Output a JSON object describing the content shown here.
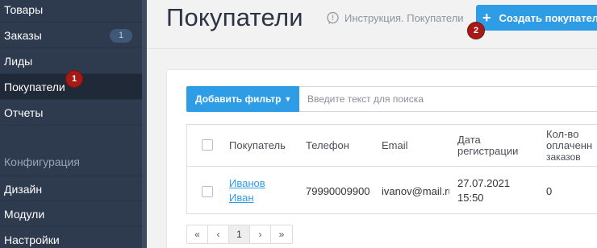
{
  "sidebar": {
    "items": [
      {
        "label": "Товары",
        "badge": ""
      },
      {
        "label": "Заказы",
        "badge": "1"
      },
      {
        "label": "Лиды",
        "badge": ""
      },
      {
        "label": "Покупатели",
        "badge": "",
        "active": true
      },
      {
        "label": "Отчеты",
        "badge": ""
      }
    ],
    "section_label": "Конфигурация",
    "config_items": [
      {
        "label": "Дизайн"
      },
      {
        "label": "Модули"
      },
      {
        "label": "Настройки"
      }
    ]
  },
  "markers": [
    "1",
    "2"
  ],
  "header": {
    "title": "Покупатели",
    "help_link": "Инструкция. Покупатели",
    "create_button": "Создать покупателя",
    "create_icon": "+"
  },
  "filter": {
    "add_filter_label": "Добавить фильтр",
    "search_placeholder": "Введите текст для поиска"
  },
  "table": {
    "columns": [
      "Покупатель",
      "Телефон",
      "Email",
      "Дата регистрации",
      "Кол-во оплаченных заказов"
    ],
    "column_lines": {
      "date": [
        "Дата",
        "регистрации"
      ],
      "orders": [
        "Кол-во",
        "оплаченн",
        "заказов"
      ]
    },
    "rows": [
      {
        "name_line1": "Иванов",
        "name_line2": "Иван",
        "phone": "79990009900",
        "email": "ivanov@mail.ru",
        "date_line1": "27.07.2021",
        "date_line2": "15:50",
        "orders": "0"
      }
    ]
  },
  "pagination": {
    "first": "«",
    "prev": "‹",
    "current": "1",
    "next": "›",
    "last": "»"
  },
  "colors": {
    "sidebar": "#2e3a4d",
    "accent": "#2f9de6",
    "marker": "#a51a16"
  }
}
